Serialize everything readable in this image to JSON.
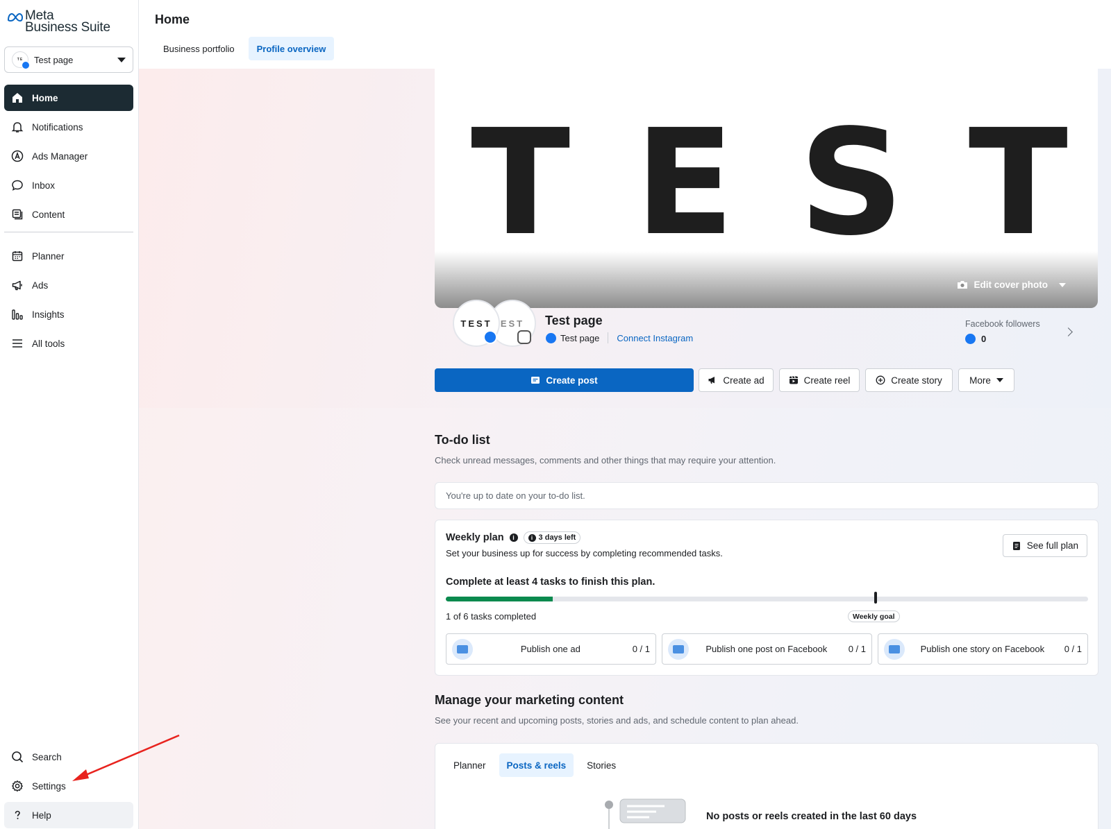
{
  "brand": {
    "line1": "Meta",
    "line2": "Business Suite"
  },
  "page_selector": {
    "label": "Test page"
  },
  "nav": {
    "primary": [
      {
        "label": "Home",
        "icon": "home-icon",
        "active": true
      },
      {
        "label": "Notifications",
        "icon": "bell-icon"
      },
      {
        "label": "Ads Manager",
        "icon": "ads-manager-icon"
      },
      {
        "label": "Inbox",
        "icon": "chat-bubble-icon"
      },
      {
        "label": "Content",
        "icon": "content-icon"
      }
    ],
    "secondary": [
      {
        "label": "Planner",
        "icon": "calendar-icon"
      },
      {
        "label": "Ads",
        "icon": "megaphone-icon"
      },
      {
        "label": "Insights",
        "icon": "bar-chart-icon"
      },
      {
        "label": "All tools",
        "icon": "menu-icon"
      }
    ],
    "bottom": [
      {
        "label": "Search",
        "icon": "search-icon"
      },
      {
        "label": "Settings",
        "icon": "gear-icon"
      },
      {
        "label": "Help",
        "icon": "question-icon"
      }
    ]
  },
  "header": {
    "title": "Home",
    "tabs": [
      {
        "label": "Business portfolio",
        "active": false
      },
      {
        "label": "Profile overview",
        "active": true
      }
    ]
  },
  "cover": {
    "text": "TEST",
    "letters": [
      "T",
      "E",
      "S",
      "T"
    ],
    "edit_label": "Edit cover photo"
  },
  "profile": {
    "avatar_text": "TEST",
    "avatar2_text": "EST",
    "name": "Test page",
    "fb_page_label": "Test page",
    "connect_label": "Connect Instagram",
    "followers_label": "Facebook followers",
    "followers_count": "0"
  },
  "actions": {
    "create_post": "Create post",
    "create_ad": "Create ad",
    "create_reel": "Create reel",
    "create_story": "Create story",
    "more": "More"
  },
  "todo": {
    "title": "To-do list",
    "description": "Check unread messages, comments and other things that may require your attention.",
    "status": "You're up to date on your to-do list."
  },
  "weekly_plan": {
    "title": "Weekly plan",
    "days_left": "3 days left",
    "description": "Set your business up for success by completing recommended tasks.",
    "see_full_plan": "See full plan",
    "goal_text": "Complete at least 4 tasks to finish this plan.",
    "progress": {
      "completed": 1,
      "total": 6,
      "goal": 4
    },
    "count_text": "1 of 6 tasks completed",
    "goal_label": "Weekly goal",
    "tasks": [
      {
        "label": "Publish one ad",
        "progress": "0 / 1"
      },
      {
        "label": "Publish one post on Facebook",
        "progress": "0 / 1"
      },
      {
        "label": "Publish one story on Facebook",
        "progress": "0 / 1"
      }
    ]
  },
  "manage": {
    "title": "Manage your marketing content",
    "description": "See your recent and upcoming posts, stories and ads, and schedule content to plan ahead.",
    "tabs": [
      {
        "label": "Planner",
        "active": false
      },
      {
        "label": "Posts & reels",
        "active": true
      },
      {
        "label": "Stories",
        "active": false
      }
    ],
    "empty_title": "No posts or reels created in the last 60 days"
  },
  "colors": {
    "primary": "#0a66c2",
    "nav_active": "#1c2b33",
    "progress": "#0b8a4e",
    "annotation": "#e8231e"
  }
}
